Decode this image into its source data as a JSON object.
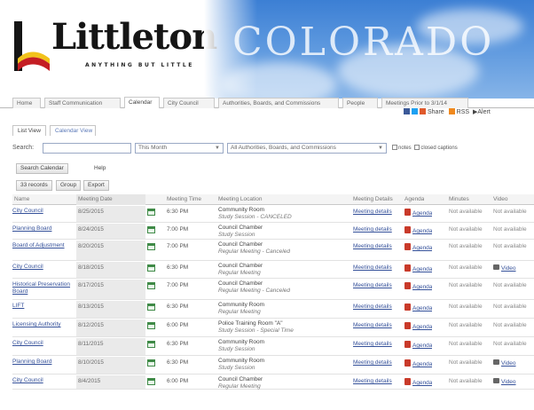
{
  "brand": {
    "logo_text": "Littleton",
    "tagline": "ANYTHING BUT LITTLE",
    "state_text": "COLORADO",
    "colors": {
      "sky": "#5b97de",
      "logo_red": "#c41e24",
      "logo_yellow": "#f2c21b",
      "link": "#35519a"
    }
  },
  "tabs": [
    "Home",
    "Staff Communication",
    "Calendar",
    "City Council",
    "Authorities, Boards, and Commissions",
    "People",
    "Meetings Prior to 3/1/14"
  ],
  "share": {
    "label": "Share",
    "rss": "RSS",
    "alerts": "Alert"
  },
  "view_tabs": [
    "List View",
    "Calendar View"
  ],
  "search": {
    "label": "Search:",
    "value": "",
    "period": "This Month",
    "body": "All Authorities, Boards, and Commissions",
    "notes_label": "notes",
    "captions_label": "closed captions"
  },
  "buttons": {
    "search_calendar": "Search Calendar",
    "help": "Help"
  },
  "toolbar": {
    "records": "33 records",
    "group": "Group",
    "export": "Export"
  },
  "columns": [
    "Name",
    "Meeting Date",
    "",
    "Meeting Time",
    "Meeting Location",
    "Meeting Details",
    "Agenda",
    "Minutes",
    "Video"
  ],
  "rows": [
    {
      "name": "City Council",
      "date": "8/25/2015",
      "time": "6:30 PM",
      "loc": "Community Room",
      "sub": "Study Session - CANCELED",
      "details": "Meeting details",
      "agenda": "Agenda",
      "minutes": "Not available",
      "video": "Not available"
    },
    {
      "name": "Planning Board",
      "date": "8/24/2015",
      "time": "7:00 PM",
      "loc": "Council Chamber",
      "sub": "Study Session",
      "details": "Meeting details",
      "agenda": "Agenda",
      "minutes": "Not available",
      "video": "Not available"
    },
    {
      "name": "Board of Adjustment",
      "date": "8/20/2015",
      "time": "7:00 PM",
      "loc": "Council Chamber",
      "sub": "Regular Meeting - Canceled",
      "details": "Meeting details",
      "agenda": "Agenda",
      "minutes": "Not available",
      "video": "Not available"
    },
    {
      "name": "City Council",
      "date": "8/18/2015",
      "time": "6:30 PM",
      "loc": "Council Chamber",
      "sub": "Regular Meeting",
      "details": "Meeting details",
      "agenda": "Agenda",
      "minutes": "Not available",
      "video": "Video"
    },
    {
      "name": "Historical Preservation Board",
      "date": "8/17/2015",
      "time": "7:00 PM",
      "loc": "Council Chamber",
      "sub": "Regular Meeting - Canceled",
      "details": "Meeting details",
      "agenda": "Agenda",
      "minutes": "Not available",
      "video": "Not available"
    },
    {
      "name": "LIFT",
      "date": "8/13/2015",
      "time": "6:30 PM",
      "loc": "Community Room",
      "sub": "Regular Meeting",
      "details": "Meeting details",
      "agenda": "Agenda",
      "minutes": "Not available",
      "video": "Not available"
    },
    {
      "name": "Licensing Authority",
      "date": "8/12/2015",
      "time": "6:00 PM",
      "loc": "Police Training Room \"A\"",
      "sub": "Study Session - Special Time",
      "details": "Meeting details",
      "agenda": "Agenda",
      "minutes": "Not available",
      "video": "Not available"
    },
    {
      "name": "City Council",
      "date": "8/11/2015",
      "time": "6:30 PM",
      "loc": "Community Room",
      "sub": "Study Session",
      "details": "Meeting details",
      "agenda": "Agenda",
      "minutes": "Not available",
      "video": "Not available"
    },
    {
      "name": "Planning Board",
      "date": "8/10/2015",
      "time": "6:30 PM",
      "loc": "Community Room",
      "sub": "Study Session",
      "details": "Meeting details",
      "agenda": "Agenda",
      "minutes": "Not available",
      "video": "Video"
    },
    {
      "name": "City Council",
      "date": "8/4/2015",
      "time": "6:00 PM",
      "loc": "Council Chamber",
      "sub": "Regular Meeting",
      "details": "Meeting details",
      "agenda": "Agenda",
      "minutes": "Not available",
      "video": "Video"
    }
  ]
}
